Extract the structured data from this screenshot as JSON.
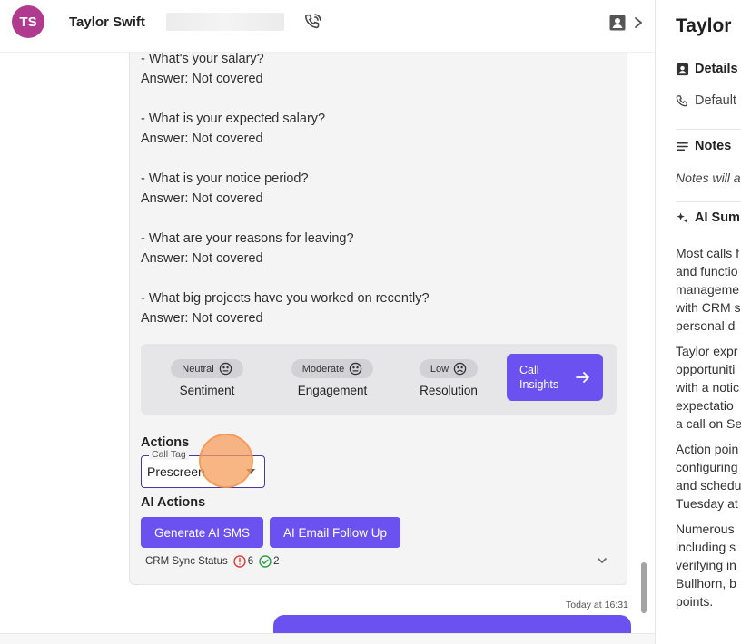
{
  "header": {
    "avatar_initials": "TS",
    "contact_name": "Taylor Swift"
  },
  "transcript": {
    "questions": [
      {
        "question": "- What's your salary?",
        "answer": "Answer: Not covered"
      },
      {
        "question": "- What is your expected salary?",
        "answer": "Answer: Not covered"
      },
      {
        "question": "- What is your notice period?",
        "answer": "Answer: Not covered"
      },
      {
        "question": "- What are your reasons for leaving?",
        "answer": "Answer: Not covered"
      },
      {
        "question": "- What big projects have you worked on recently?",
        "answer": "Answer: Not covered"
      }
    ]
  },
  "metrics": [
    {
      "pill": "Neutral",
      "label": "Sentiment"
    },
    {
      "pill": "Moderate",
      "label": "Engagement"
    },
    {
      "pill": "Low",
      "label": "Resolution"
    }
  ],
  "insights_button": {
    "label": "Call\nInsights"
  },
  "actions": {
    "title": "Actions",
    "call_tag_legend": "Call Tag",
    "call_tag_value": "Prescreen"
  },
  "ai_actions": {
    "title": "AI Actions",
    "generate_sms": "Generate AI SMS",
    "email_follow_up": "AI Email Follow Up"
  },
  "crm": {
    "label": "CRM Sync Status",
    "error_count": "6",
    "success_count": "2"
  },
  "timestamp": "Today at 16:31",
  "right_panel": {
    "title": "Taylor",
    "details": "Details",
    "default": "Default",
    "notes": "Notes",
    "notes_placeholder": "Notes will a",
    "ai_summary": "AI Sum",
    "summary_lines": [
      "Most calls f",
      "and functio",
      "manageme",
      "with CRM s",
      "personal d",
      "Taylor expr",
      "opportuniti",
      "with a notic",
      "expectatio",
      "a call on Se",
      "Action poin",
      "configuring",
      "and schedu",
      "Tuesday at",
      "Numerous",
      "including s",
      "verifying in",
      "Bullhorn, b",
      "points."
    ]
  },
  "colors": {
    "accent": "#6b52f0",
    "avatar": "#b03a8e",
    "error": "#e53935",
    "success": "#2e9e44"
  }
}
